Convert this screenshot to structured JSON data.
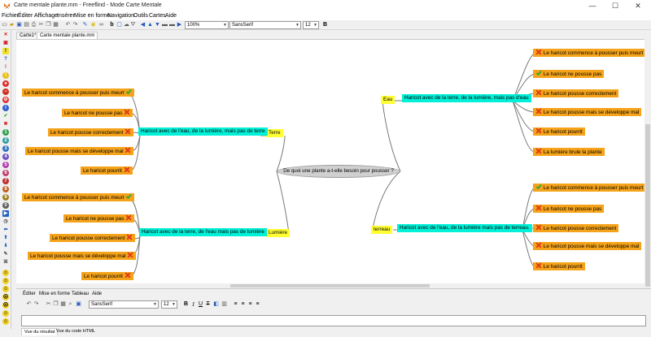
{
  "window": {
    "title": "Carte mentale plante.mm - Freeflind - Mode Carte Mentale",
    "controls": [
      "—",
      "☐",
      "✕"
    ]
  },
  "menu": [
    "Fichier",
    "Éditer",
    "Affichage",
    "Insérer",
    "Mise en forme",
    "Navigation",
    "Outils",
    "Cartes",
    "Aide"
  ],
  "toolbar": {
    "zoom": "100%",
    "font": "SansSerif",
    "size": "12"
  },
  "tabs": [
    "Carte1*",
    "Carte mentale plante.mm"
  ],
  "map": {
    "central": "De quoi une plante a-t-elle  besoin pour pousser ?",
    "left_top": {
      "category": "Terre",
      "branch": "Haricot avec de l'eau, de la lumière, mais pas de terre",
      "leaves": [
        {
          "text": "Le haricot commence à pousser puis meurt",
          "icon": "green-check-icon"
        },
        {
          "text": "Le haricot ne pousse pas",
          "icon": "red-cross-icon"
        },
        {
          "text": "Le haricot pousse correctement",
          "icon": "red-cross-icon"
        },
        {
          "text": "Le haricot pousse mais se développe mal",
          "icon": "red-cross-icon"
        },
        {
          "text": "Le haricot pourrit",
          "icon": "red-cross-icon"
        }
      ]
    },
    "left_bottom": {
      "category": "Lumière",
      "branch": "Haricot avec de la terre, de l'eau mais pas de lumière",
      "leaves": [
        {
          "text": "Le haricot commence à pousser puis meurt",
          "icon": "green-check-icon"
        },
        {
          "text": "Le haricot ne pousse pas",
          "icon": "red-cross-icon"
        },
        {
          "text": "Le haricot pousse correctement",
          "icon": "red-cross-icon"
        },
        {
          "text": "Le haricot pousse mais se développe mal",
          "icon": "red-cross-icon"
        },
        {
          "text": "Le haricot pourrit",
          "icon": "red-cross-icon"
        }
      ]
    },
    "right_top": {
      "category": "Eau",
      "branch": "Haricot avec de la terre, de la lumière, mais pas d'eau",
      "leaves": [
        {
          "text": "Le haricot commence à pousser puis meurt",
          "icon": "red-cross-icon"
        },
        {
          "text": "Le haricot ne pousse pas",
          "icon": "green-check-icon"
        },
        {
          "text": "Le haricot pousse correctement",
          "icon": "red-cross-icon"
        },
        {
          "text": "Le haricot pousse mais se développe mal",
          "icon": "red-cross-icon"
        },
        {
          "text": "Le haricot pourrit",
          "icon": "red-cross-icon"
        },
        {
          "text": "La lumière brule la plante",
          "icon": "red-cross-icon"
        }
      ]
    },
    "right_bottom": {
      "category": "terreau",
      "branch": "Haricot avec de l'eau, de la lumière mais pas de terreau.",
      "leaves": [
        {
          "text": "Le haricot commence à pousser puis meurt",
          "icon": "green-check-icon"
        },
        {
          "text": "Le haricot ne pousse pas",
          "icon": "red-cross-icon"
        },
        {
          "text": "Le haricot pousse correctement",
          "icon": "red-cross-icon"
        },
        {
          "text": "Le haricot pousse mais se développe mal",
          "icon": "red-cross-icon"
        },
        {
          "text": "Le haricot pourrit",
          "icon": "red-cross-icon"
        }
      ]
    }
  },
  "editor": {
    "menu": [
      "Éditer",
      "Mise en forme",
      "Tableau",
      "Aide"
    ],
    "font": "SansSerif",
    "size": "12",
    "tabs": [
      "Vue du résultat",
      "Vue du code HTML"
    ]
  },
  "colors": {
    "leaf": "#f5a31a",
    "branch": "#00f0d8",
    "category": "#ffff33",
    "central": "#d0d0d0"
  }
}
